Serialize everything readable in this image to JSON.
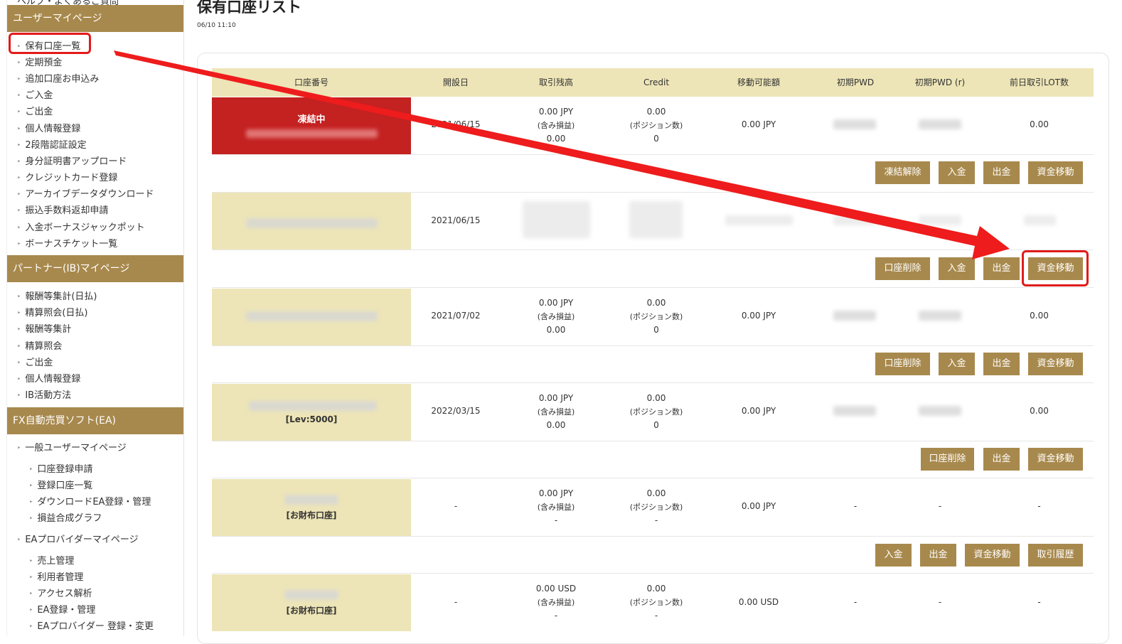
{
  "sidebar": {
    "top_cut": "ヘルプ・よくあるご質問",
    "user_header": "ユーザーマイページ",
    "user_items": [
      "保有口座一覧",
      "定期預金",
      "追加口座お申込み",
      "ご入金",
      "ご出金",
      "個人情報登録",
      "2段階認証設定",
      "身分証明書アップロード",
      "クレジットカード登録",
      "アーカイブデータダウンロード",
      "振込手数料返却申請",
      "入金ボーナスジャックポット",
      "ボーナスチケット一覧"
    ],
    "partner_header": "パートナー(IB)マイページ",
    "partner_items": [
      "報酬等集計(日払)",
      "精算照会(日払)",
      "報酬等集計",
      "精算照会",
      "ご出金",
      "個人情報登録",
      "IB活動方法"
    ],
    "ea_header": "FX自動売買ソフト(EA)",
    "ea_general": "一般ユーザーマイページ",
    "ea_general_items": [
      "口座登録申請",
      "登録口座一覧",
      "ダウンロードEA登録・管理",
      "損益合成グラフ"
    ],
    "ea_provider": "EAプロバイダーマイページ",
    "ea_provider_items": [
      "売上管理",
      "利用者管理",
      "アクセス解析",
      "EA登録・管理",
      "EAプロバイダー 登録・変更"
    ]
  },
  "main": {
    "title": "保有口座リスト",
    "datetime": "06/10 11:10",
    "columns": [
      "口座番号",
      "開設日",
      "取引残高",
      "Credit",
      "移動可能額",
      "初期PWD",
      "初期PWD (r)",
      "前日取引LOT数"
    ],
    "rows": [
      {
        "status": "凍結中",
        "lev": "",
        "date": "2021/06/15",
        "bal1": "0.00 JPY",
        "bal2": "(含み損益)",
        "bal3": "0.00",
        "cr1": "0.00",
        "cr2": "(ポジション数)",
        "cr3": "0",
        "movable": "0.00 JPY",
        "lot": "0.00",
        "buttons": [
          "凍結解除",
          "入金",
          "出金",
          "資金移動"
        ]
      },
      {
        "status": "",
        "lev": "",
        "date": "2021/06/15",
        "bal1": "",
        "bal2": "",
        "bal3": "",
        "cr1": "",
        "cr2": "",
        "cr3": "",
        "movable": "",
        "lot": "",
        "buttons": [
          "口座削除",
          "入金",
          "出金",
          "資金移動"
        ]
      },
      {
        "status": "",
        "lev": "",
        "date": "2021/07/02",
        "bal1": "0.00 JPY",
        "bal2": "(含み損益)",
        "bal3": "0.00",
        "cr1": "0.00",
        "cr2": "(ポジション数)",
        "cr3": "0",
        "movable": "0.00 JPY",
        "lot": "0.00",
        "buttons": [
          "口座削除",
          "入金",
          "出金",
          "資金移動"
        ]
      },
      {
        "status": "",
        "lev": "[Lev:5000]",
        "date": "2022/03/15",
        "bal1": "0.00 JPY",
        "bal2": "(含み損益)",
        "bal3": "0.00",
        "cr1": "0.00",
        "cr2": "(ポジション数)",
        "cr3": "0",
        "movable": "0.00 JPY",
        "lot": "0.00",
        "buttons": [
          "口座削除",
          "出金",
          "資金移動"
        ]
      },
      {
        "status": "",
        "lev": "[お財布口座]",
        "date": "-",
        "bal1": "0.00 JPY",
        "bal2": "(含み損益)",
        "bal3": "-",
        "cr1": "0.00",
        "cr2": "(ポジション数)",
        "cr3": "-",
        "movable": "0.00 JPY",
        "pwd": "-",
        "pwdr": "-",
        "lot": "-",
        "buttons": [
          "入金",
          "出金",
          "資金移動",
          "取引履歴"
        ]
      },
      {
        "status": "",
        "lev": "[お財布口座]",
        "date": "-",
        "bal1": "0.00 USD",
        "bal2": "(含み損益)",
        "bal3": "-",
        "cr1": "0.00",
        "cr2": "(ポジション数)",
        "cr3": "-",
        "movable": "0.00 USD",
        "pwd": "-",
        "pwdr": "-",
        "lot": "-",
        "buttons": []
      }
    ]
  },
  "colors": {
    "accent": "#a8894d",
    "header_bg": "#ede5b7",
    "frozen": "#c42121",
    "highlight": "#e21b1b"
  },
  "icons": {
    "annotation": "red-arrow-icon"
  }
}
